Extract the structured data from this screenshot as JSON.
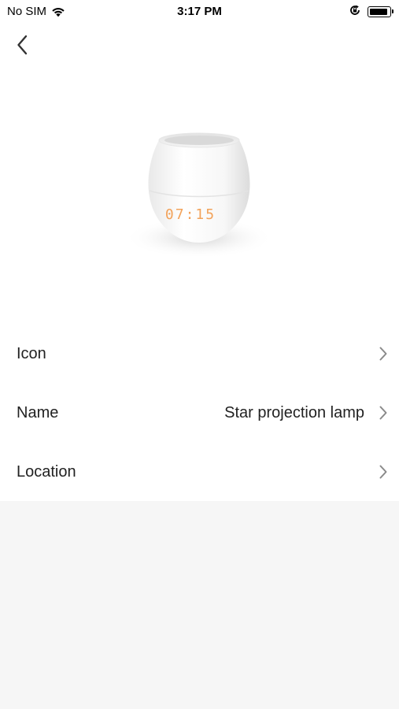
{
  "status_bar": {
    "carrier": "No SIM",
    "time": "3:17 PM",
    "icons": [
      "wifi-icon",
      "orientation-lock-icon",
      "battery-icon"
    ]
  },
  "nav": {
    "back_icon": "chevron-left-icon"
  },
  "product": {
    "display_time": "07:15",
    "display_color": "#f29a4a"
  },
  "rows": [
    {
      "label": "Icon",
      "value": ""
    },
    {
      "label": "Name",
      "value": "Star projection lamp"
    },
    {
      "label": "Location",
      "value": ""
    }
  ],
  "colors": {
    "background": "#f6f6f6",
    "card": "#ffffff",
    "chevron": "#8a8a8a"
  }
}
